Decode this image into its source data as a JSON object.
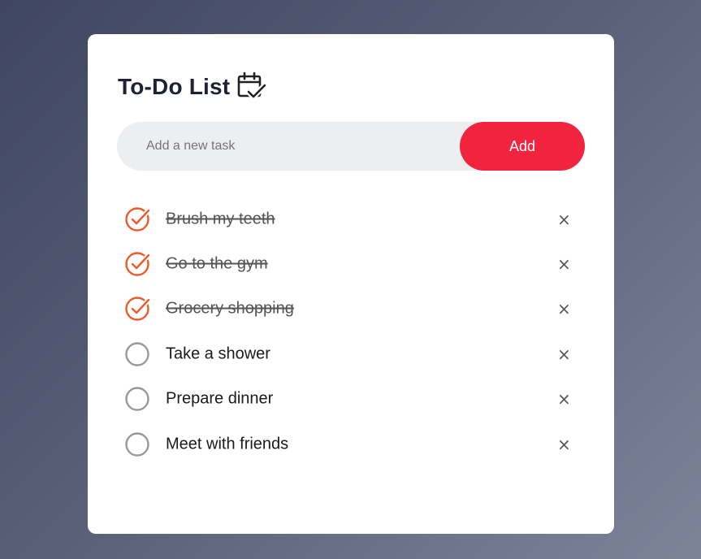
{
  "app": {
    "title": "To-Do List",
    "title_icon": "calendar-check-icon"
  },
  "input": {
    "placeholder": "Add a new task",
    "value": ""
  },
  "add_button": {
    "label": "Add"
  },
  "colors": {
    "accent": "#f0243f",
    "checked": "#f05a2a",
    "unchecked": "#999999",
    "card": "#ffffff"
  },
  "tasks": [
    {
      "text": "Brush my teeth",
      "done": true,
      "delete_icon": "×"
    },
    {
      "text": "Go to the gym",
      "done": true,
      "delete_icon": "×"
    },
    {
      "text": "Grocery shopping",
      "done": true,
      "delete_icon": "×"
    },
    {
      "text": "Take a shower",
      "done": false,
      "delete_icon": "×"
    },
    {
      "text": "Prepare dinner",
      "done": false,
      "delete_icon": "×"
    },
    {
      "text": "Meet with friends",
      "done": false,
      "delete_icon": "×"
    }
  ]
}
